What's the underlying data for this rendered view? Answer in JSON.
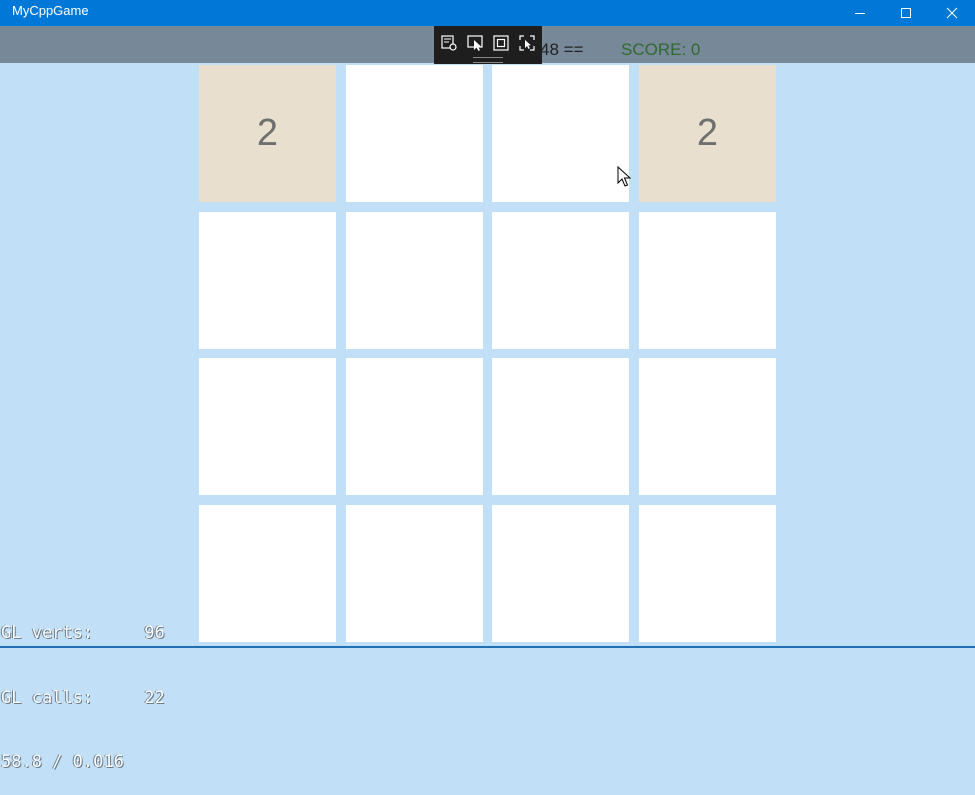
{
  "window": {
    "title": "MyCppGame",
    "minimize_icon": "minimize-icon",
    "maximize_icon": "maximize-icon",
    "close_icon": "close-icon"
  },
  "header": {
    "title_fragment": "48 ==",
    "score": "SCORE: 0"
  },
  "debug_toolbar": {
    "icons": [
      "live-visual-tree-icon",
      "select-element-icon",
      "display-layout-adorners-icon",
      "track-focused-element-icon"
    ]
  },
  "board": {
    "rows": [
      [
        "2",
        "",
        "",
        "2"
      ],
      [
        "",
        "",
        "",
        ""
      ],
      [
        "",
        "",
        "",
        ""
      ],
      [
        "",
        "",
        "",
        ""
      ]
    ]
  },
  "stats": {
    "gl_verts": "GL verts:     96",
    "gl_calls": "GL calls:     22",
    "fps": "58.8 / 0.016"
  },
  "colors": {
    "background": "#c1dff7",
    "titlebar": "#0078d7",
    "header_strip": "#778899",
    "tile_empty": "#ffffff",
    "tile_2": "#e8dfcf",
    "tile_text": "#6f6f6f",
    "score_text": "#2e6b2e"
  }
}
